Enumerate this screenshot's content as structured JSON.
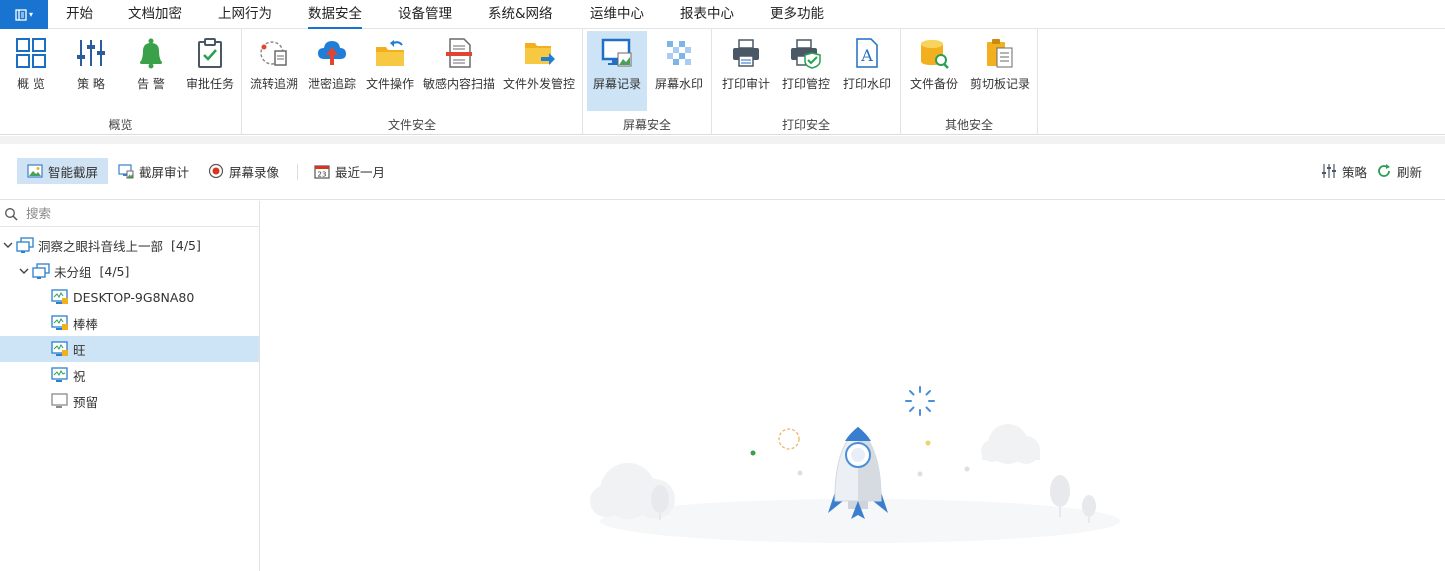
{
  "menubar": {
    "app_button_icon": "app-menu-icon",
    "items": [
      "开始",
      "文档加密",
      "上网行为",
      "数据安全",
      "设备管理",
      "系统&网络",
      "运维中心",
      "报表中心",
      "更多功能"
    ],
    "active_index": 3
  },
  "ribbon": {
    "groups": {
      "overview": {
        "label": "概览",
        "buttons": [
          "概 览",
          "策 略",
          "告 警",
          "审批任务"
        ]
      },
      "file_security": {
        "label": "文件安全",
        "buttons": [
          "流转追溯",
          "泄密追踪",
          "文件操作",
          "敏感内容扫描",
          "文件外发管控"
        ]
      },
      "screen_security": {
        "label": "屏幕安全",
        "buttons": [
          "屏幕记录",
          "屏幕水印"
        ]
      },
      "print_security": {
        "label": "打印安全",
        "buttons": [
          "打印审计",
          "打印管控",
          "打印水印"
        ]
      },
      "other_security": {
        "label": "其他安全",
        "buttons": [
          "文件备份",
          "剪切板记录"
        ]
      }
    },
    "selected_button": "屏幕记录"
  },
  "toolbar": {
    "smart_capture": "智能截屏",
    "screenshot_audit": "截屏审计",
    "screen_recording": "屏幕录像",
    "date_range": "最近一月",
    "date_icon_day": "23",
    "policy": "策略",
    "refresh": "刷新"
  },
  "sidebar": {
    "search_placeholder": "搜索",
    "tree": {
      "root": {
        "label": "洞察之眼抖音线上一部",
        "count": "[4/5]"
      },
      "group": {
        "label": "未分组",
        "count": "[4/5]"
      },
      "devices": [
        {
          "label": "DESKTOP-9G8NA80",
          "status": "online-locked"
        },
        {
          "label": "棒棒",
          "status": "online-locked"
        },
        {
          "label": "旺",
          "status": "online-locked"
        },
        {
          "label": "祝",
          "status": "online"
        },
        {
          "label": "预留",
          "status": "offline"
        }
      ],
      "selected_device": "旺"
    }
  },
  "colors": {
    "accent": "#1874d0",
    "selected_bg": "#cde3f6",
    "divider": "#e2e2e2"
  },
  "content": {
    "state": "loading",
    "illustration": "rocket-illustration"
  }
}
